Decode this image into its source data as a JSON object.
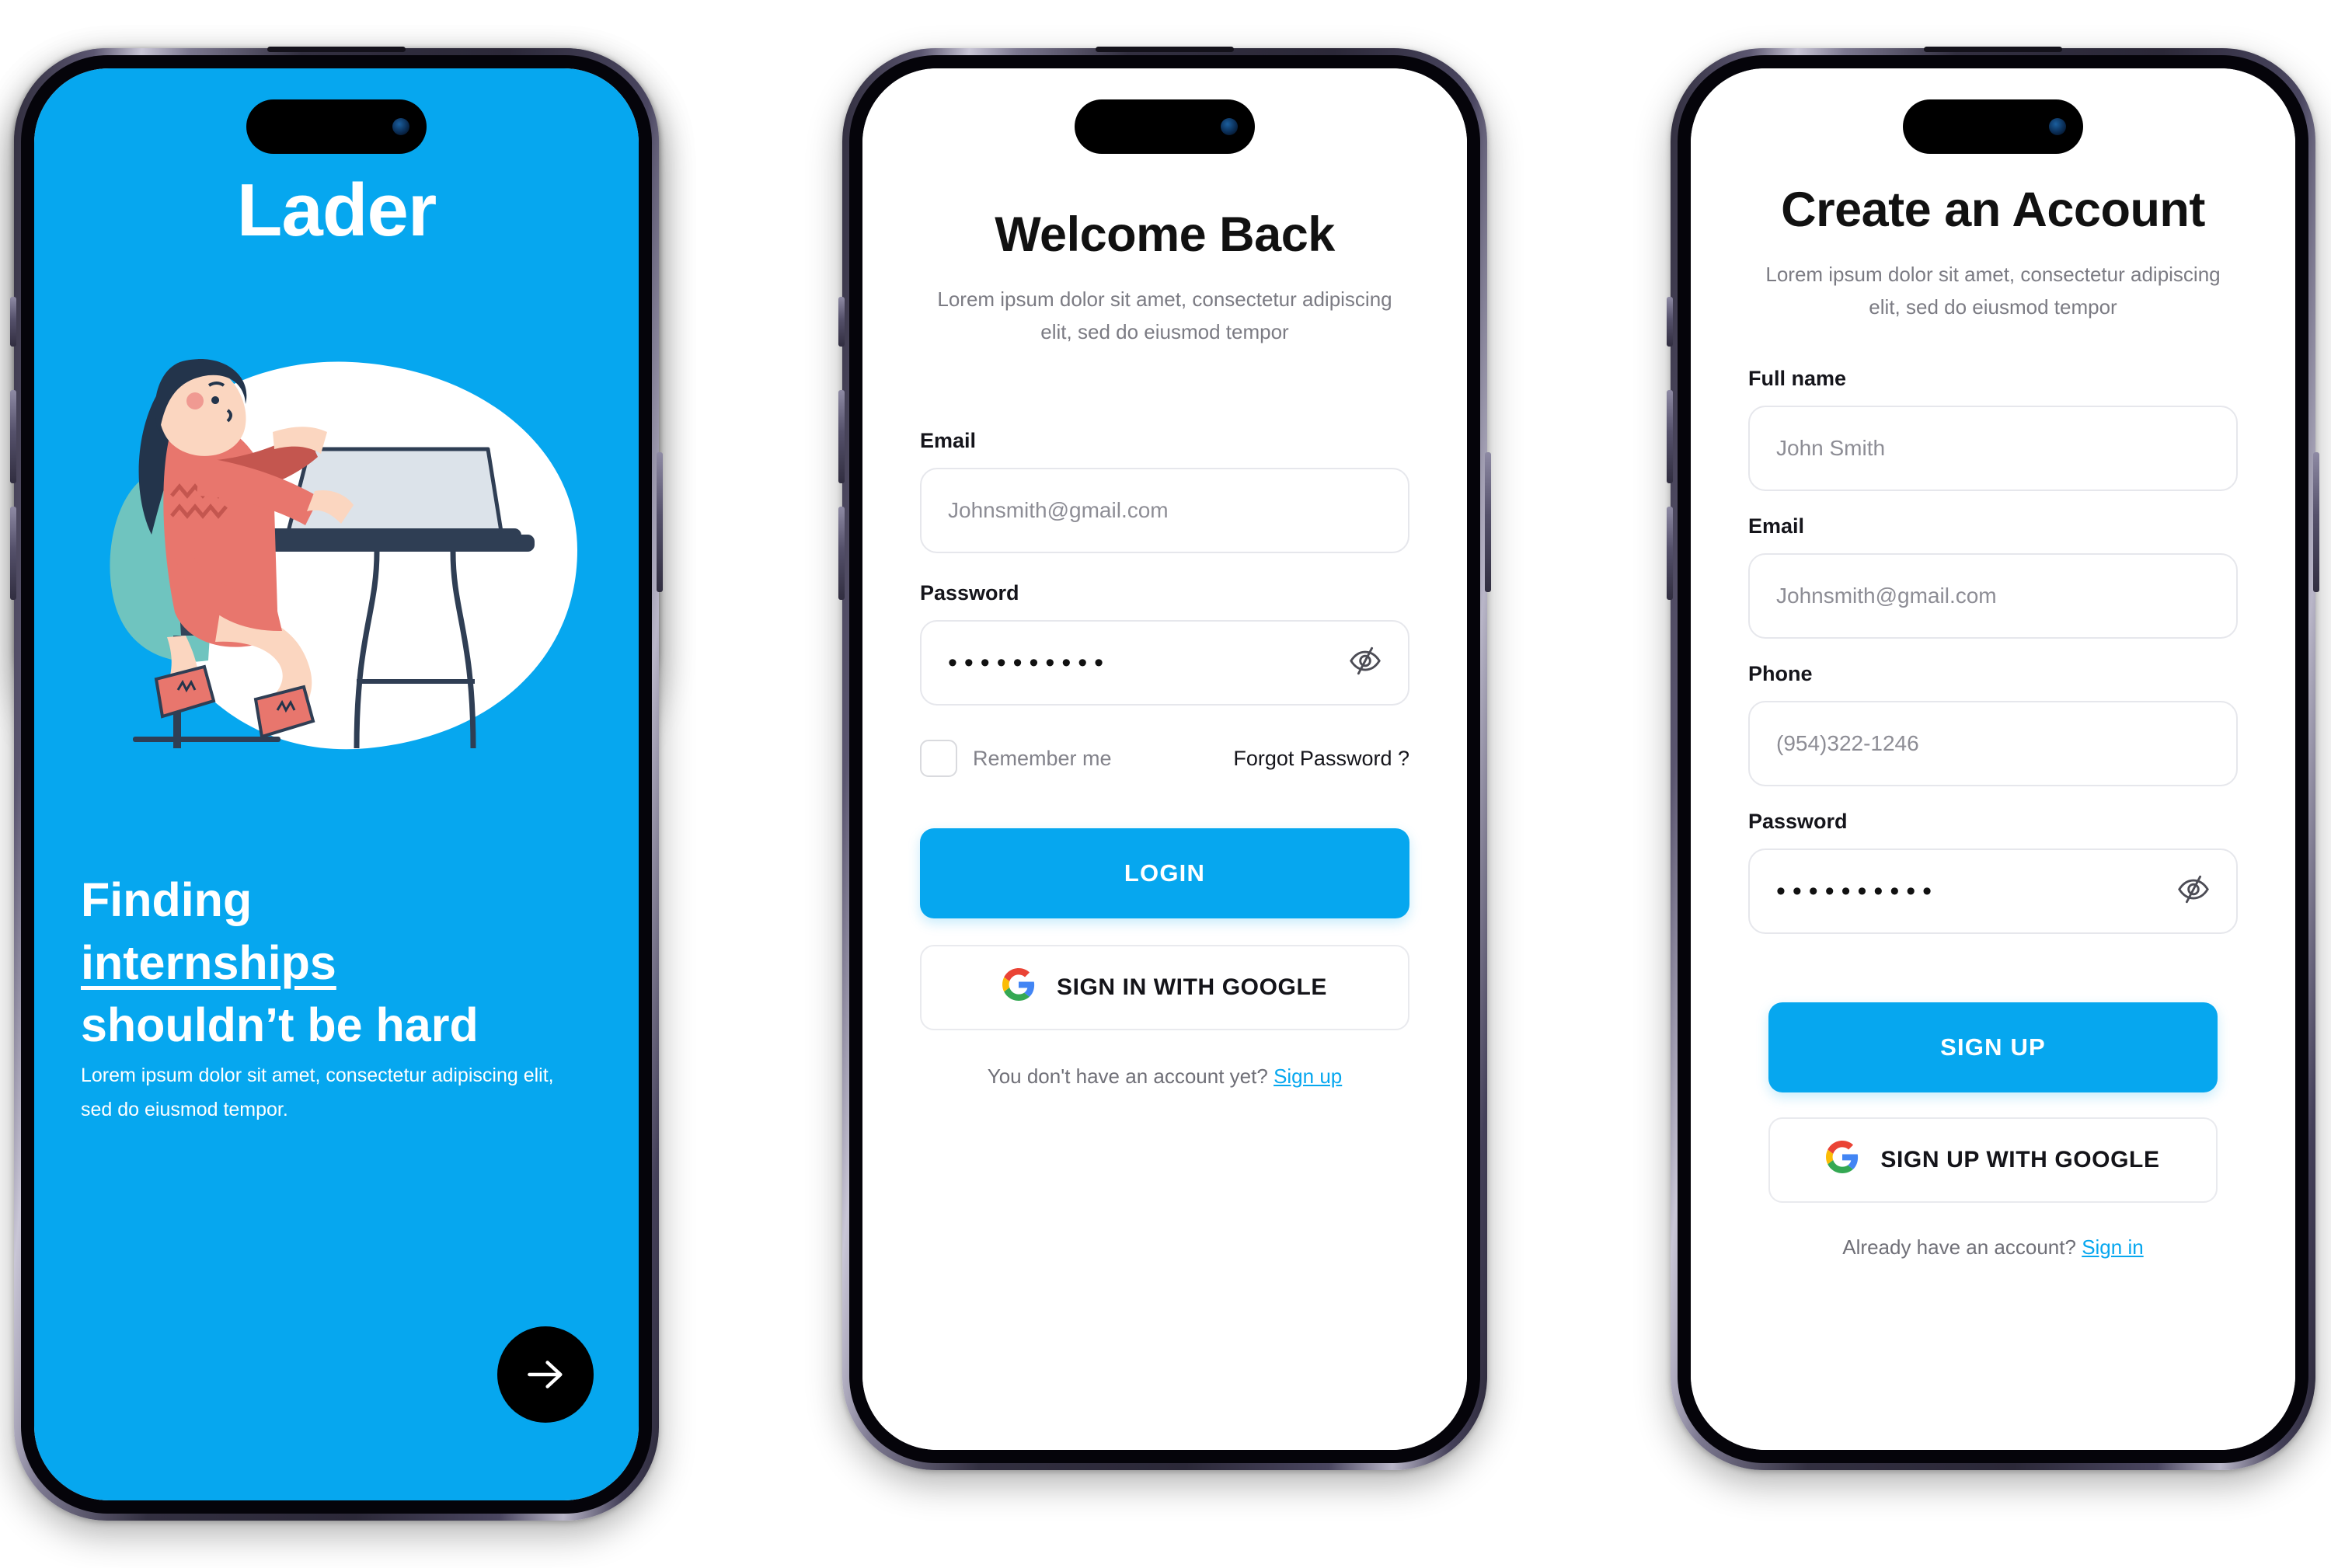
{
  "brand": {
    "accent": "#06A7EF",
    "dark": "#000000",
    "muted": "#7b7b83"
  },
  "screens": {
    "onboarding": {
      "logo": "Lader",
      "headline_line1": "Finding",
      "headline_line2": "internships",
      "headline_line3": "shouldn’t be hard",
      "subtext": "Lorem ipsum dolor sit amet, consectetur adipiscing elit, sed do eiusmod tempor.",
      "next_icon": "arrow-right-icon"
    },
    "login": {
      "title": "Welcome Back",
      "subtitle": "Lorem ipsum dolor sit amet, consectetur adipiscing elit, sed do eiusmod tempor",
      "email_label": "Email",
      "email_value": "Johnsmith@gmail.com",
      "password_label": "Password",
      "password_value": "••••••••••",
      "password_toggle_icon": "eye-slash-icon",
      "remember_label": "Remember me",
      "forgot_label": "Forgot Password ?",
      "primary_button": "LOGIN",
      "google_button": "SIGN IN WITH GOOGLE",
      "google_icon": "google-g-icon",
      "footer_text": "You don't have an account yet?",
      "footer_link": "Sign up"
    },
    "signup": {
      "title": "Create an Account",
      "subtitle": "Lorem ipsum dolor sit amet, consectetur adipiscing elit, sed do eiusmod tempor",
      "fullname_label": "Full name",
      "fullname_value": "John Smith",
      "email_label": "Email",
      "email_value": "Johnsmith@gmail.com",
      "phone_label": "Phone",
      "phone_value": "(954)322-1246",
      "password_label": "Password",
      "password_value": "••••••••••",
      "password_toggle_icon": "eye-slash-icon",
      "primary_button": "SIGN UP",
      "google_button": "SIGN UP WITH GOOGLE",
      "google_icon": "google-g-icon",
      "footer_text": "Already have an account?",
      "footer_link": "Sign in"
    }
  }
}
